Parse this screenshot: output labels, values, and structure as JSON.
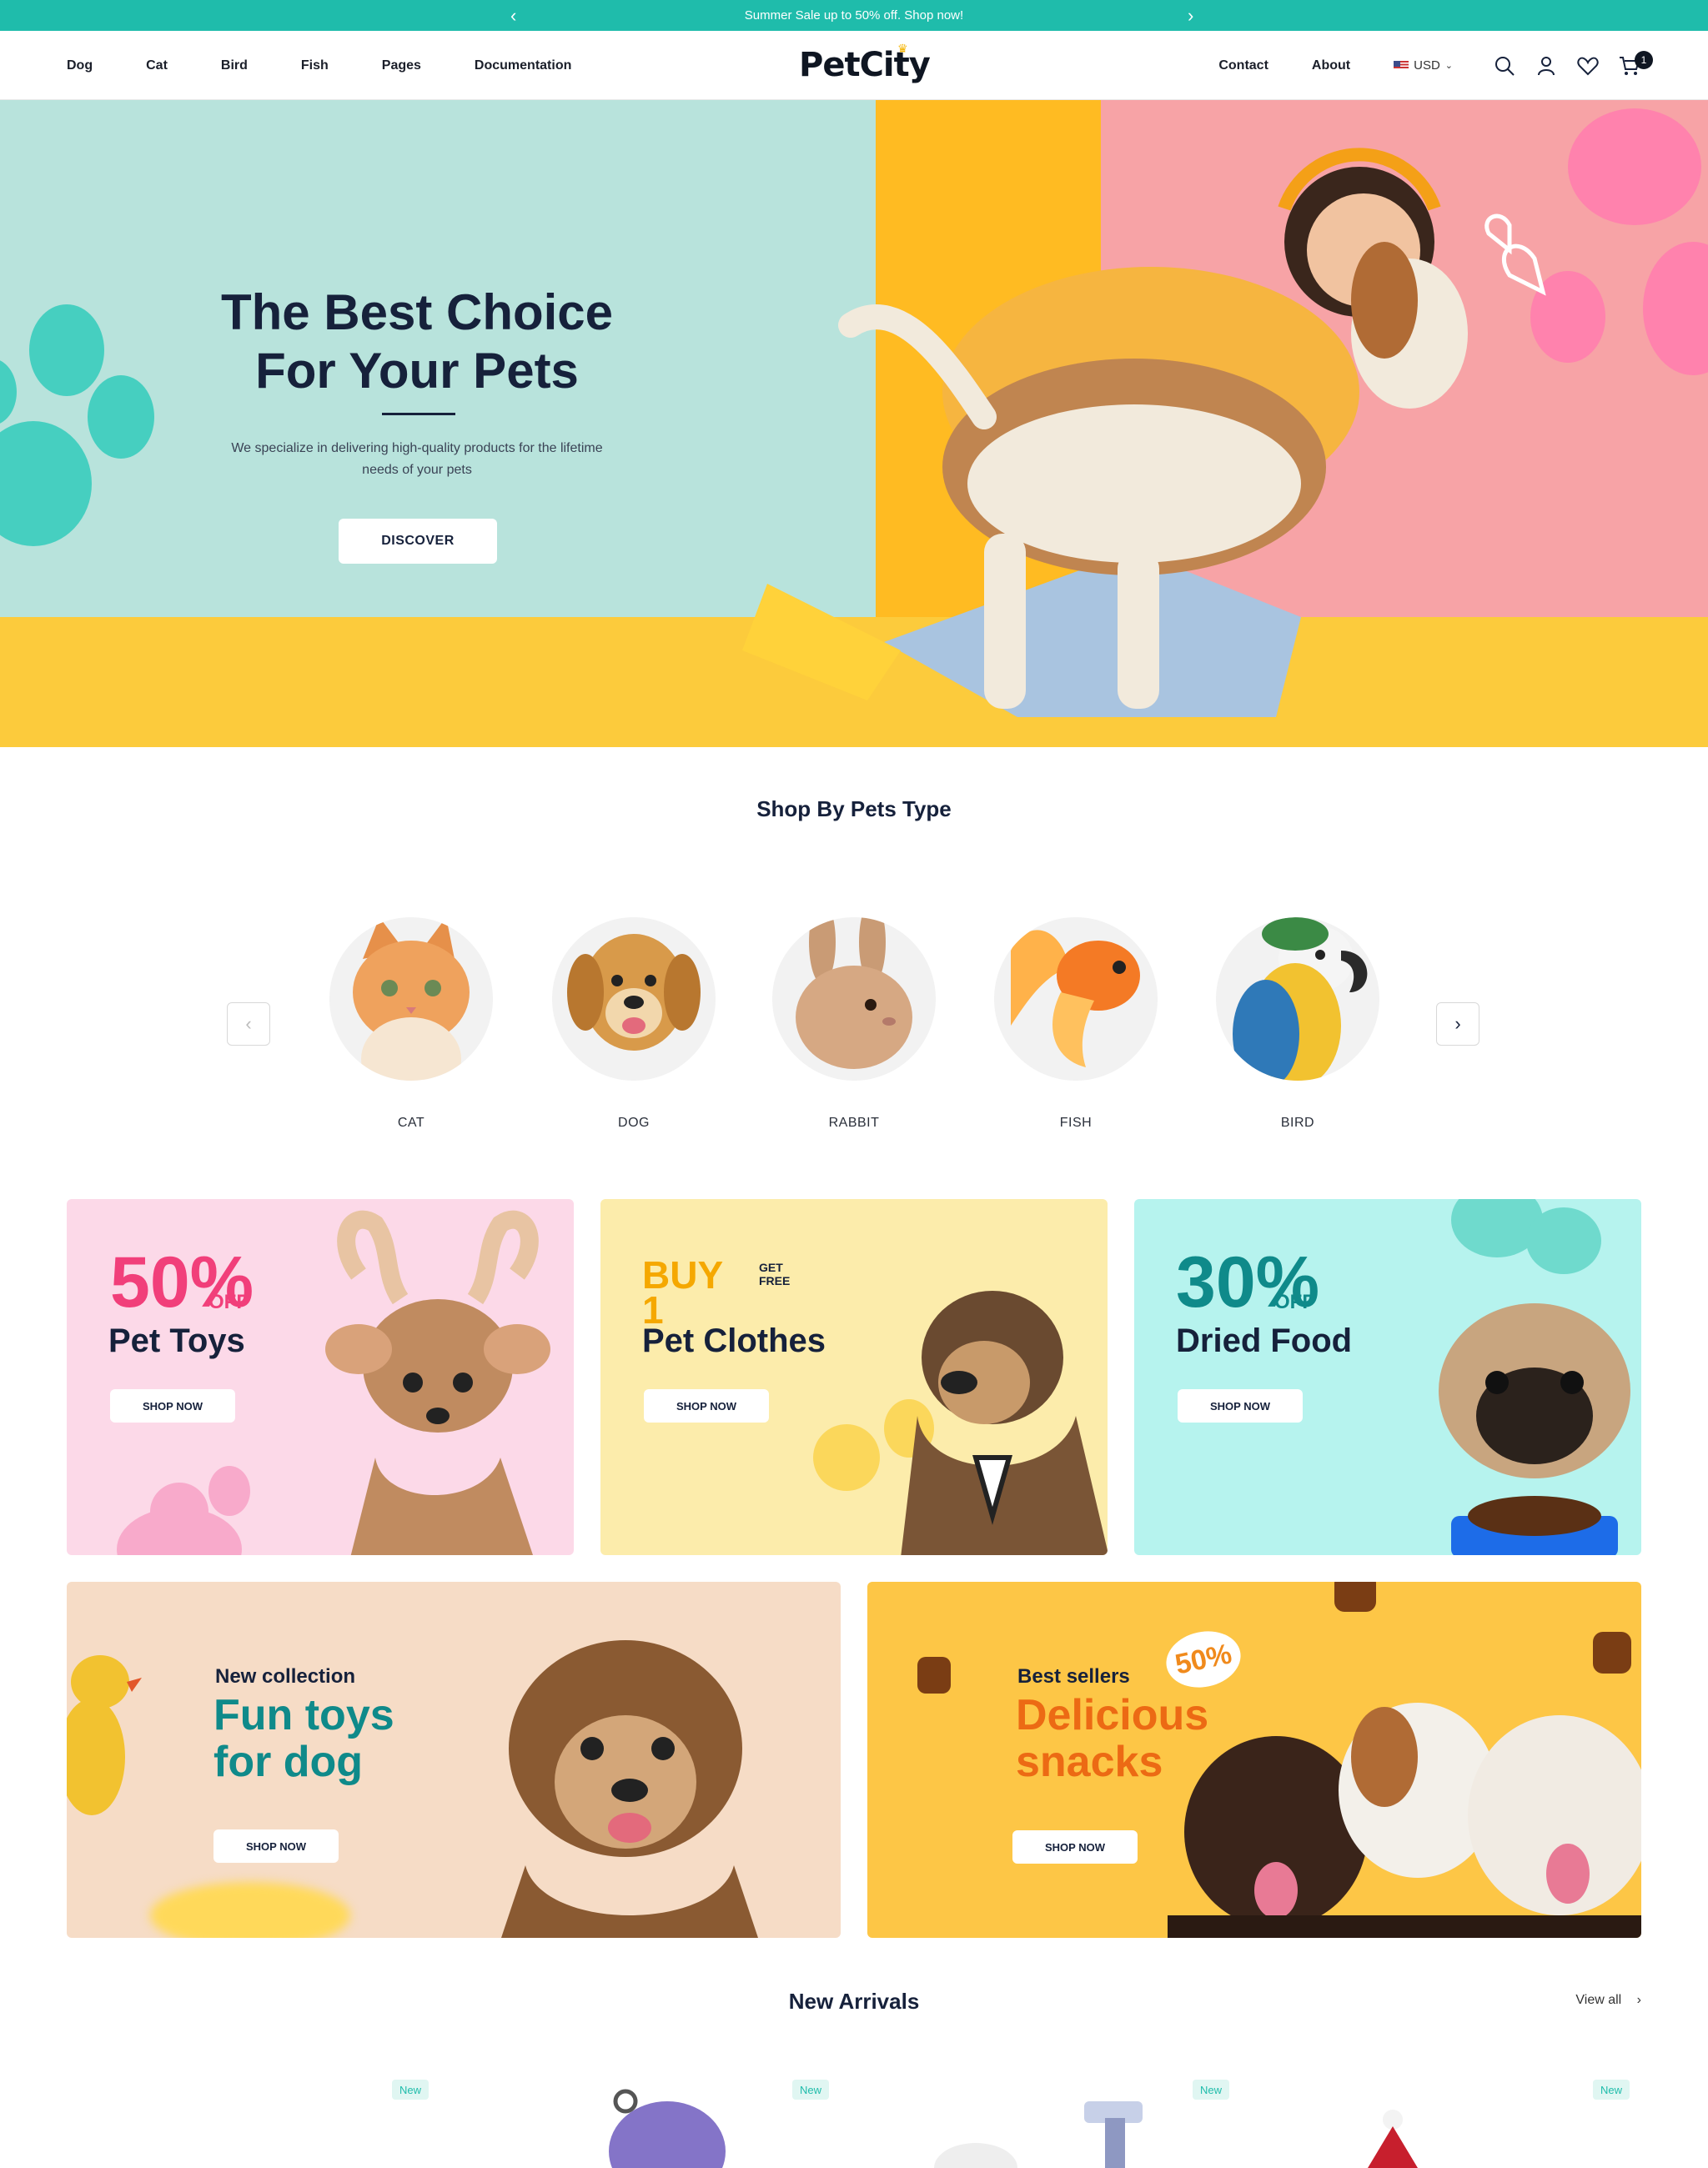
{
  "announcement": {
    "text": "Summer Sale up to 50% off. Shop now!",
    "prev": "‹",
    "next": "›"
  },
  "nav": {
    "left": [
      "Dog",
      "Cat",
      "Bird",
      "Fish",
      "Pages",
      "Documentation"
    ],
    "logo": "PetCity",
    "right": [
      "Contact",
      "About"
    ],
    "currency": "USD",
    "cart_count": "1"
  },
  "hero": {
    "title_line1": "The Best Choice",
    "title_line2": "For Your Pets",
    "subtitle": "We specialize in delivering high-quality products for the lifetime needs of your pets",
    "button": "DISCOVER"
  },
  "shop_by_type": {
    "title": "Shop By Pets Type",
    "pets": [
      {
        "label": "CAT"
      },
      {
        "label": "DOG"
      },
      {
        "label": "RABBIT"
      },
      {
        "label": "FISH"
      },
      {
        "label": "BIRD"
      }
    ]
  },
  "promos": [
    {
      "big": "50%",
      "off": "OFF",
      "title": "Pet Toys",
      "button": "SHOP NOW"
    },
    {
      "big": "BUY 1",
      "off": "GET FREE",
      "title": "Pet Clothes",
      "button": "SHOP NOW"
    },
    {
      "big": "30%",
      "off": "OFF",
      "title": "Dried Food",
      "button": "SHOP NOW"
    }
  ],
  "banners": [
    {
      "kicker": "New collection",
      "title_line1": "Fun toys",
      "title_line2": "for dog",
      "button": "SHOP NOW"
    },
    {
      "kicker": "Best sellers",
      "title_line1": "Delicious",
      "title_line2": "snacks",
      "button": "SHOP NOW",
      "sticker": "50%"
    }
  ],
  "new_arrivals": {
    "title": "New Arrivals",
    "view_all": "View all",
    "badges": [
      "New",
      "New",
      "New",
      "New"
    ]
  },
  "colors": {
    "teal": "#1fbcab",
    "navy": "#16213b",
    "pink": "#f13f7a",
    "yellow": "#ffd24a",
    "orange": "#f08a1c"
  }
}
